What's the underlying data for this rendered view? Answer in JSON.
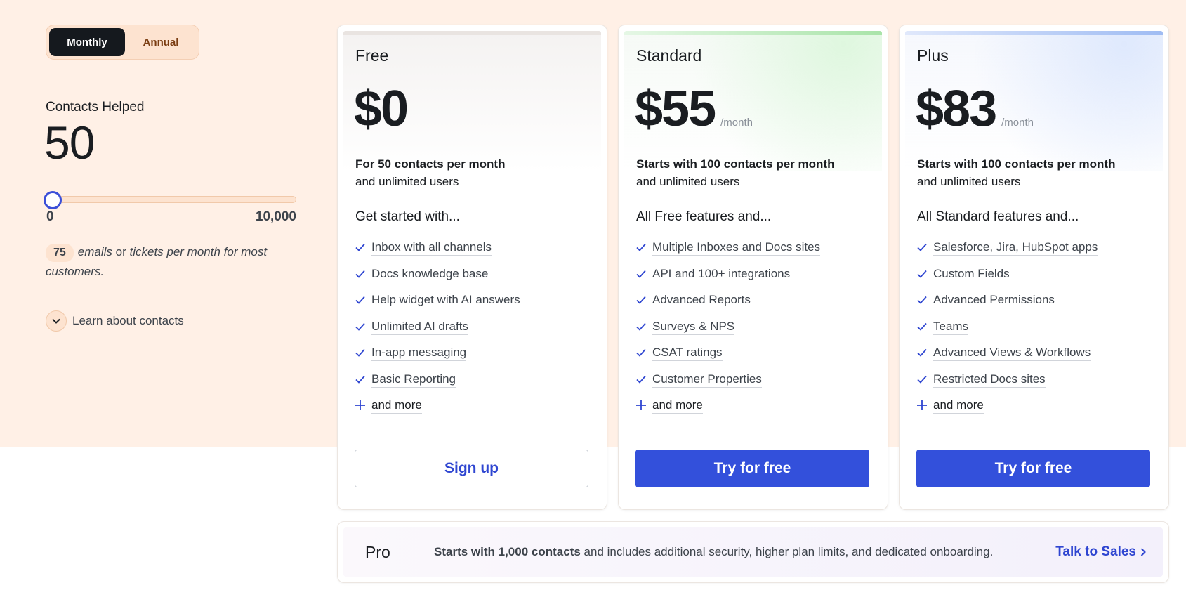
{
  "billing_toggle": {
    "monthly": "Monthly",
    "annual": "Annual"
  },
  "contacts": {
    "label": "Contacts Helped",
    "value": "50",
    "slider_min": "0",
    "slider_max": "10,000",
    "slider_position": 0,
    "hint_pill": "75",
    "hint_a": "emails",
    "hint_or": " or ",
    "hint_b": "tickets per month for most customers.",
    "learn_more": "Learn about contacts"
  },
  "plans": [
    {
      "name": "Free",
      "price": "$0",
      "per": "",
      "desc_bold": "For 50 contacts per month",
      "desc_rest": "and unlimited users",
      "features_heading": "Get started with...",
      "features": [
        "Inbox with all channels",
        "Docs knowledge base",
        "Help widget with AI answers",
        "Unlimited AI drafts",
        "In-app messaging",
        "Basic Reporting"
      ],
      "more": "and more",
      "cta": "Sign up"
    },
    {
      "name": "Standard",
      "price": "$55",
      "per": "/month",
      "desc_bold": "Starts with 100 contacts per month",
      "desc_rest": "and unlimited users",
      "features_heading": "All Free features and...",
      "features": [
        "Multiple Inboxes and Docs sites",
        "API and 100+ integrations",
        "Advanced Reports",
        "Surveys & NPS",
        "CSAT ratings",
        "Customer Properties"
      ],
      "more": "and more",
      "cta": "Try for free"
    },
    {
      "name": "Plus",
      "price": "$83",
      "per": "/month",
      "desc_bold": "Starts with 100 contacts per month",
      "desc_rest": "and unlimited users",
      "features_heading": "All Standard features and...",
      "features": [
        "Salesforce, Jira, HubSpot apps",
        "Custom Fields",
        "Advanced Permissions",
        "Teams",
        "Advanced Views & Workflows",
        "Restricted Docs sites"
      ],
      "more": "and more",
      "cta": "Try for free"
    }
  ],
  "pro": {
    "name": "Pro",
    "text_bold": "Starts with 1,000 contacts",
    "text_rest": " and includes additional security, higher plan limits, and dedicated onboarding.",
    "link": "Talk to Sales"
  },
  "colors": {
    "accent": "#3350db",
    "peach": "#fff0e6",
    "dark": "#15191e"
  }
}
